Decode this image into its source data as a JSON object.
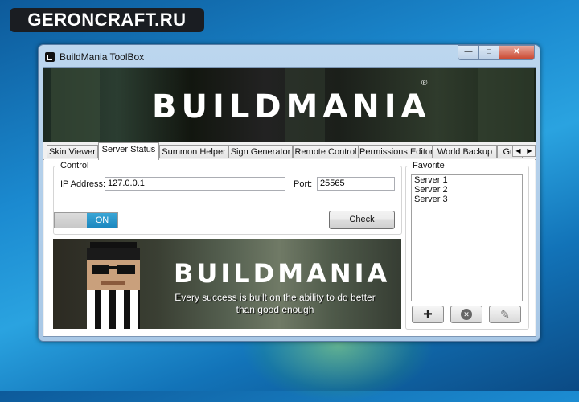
{
  "watermark": "GERONCRAFT.RU",
  "window": {
    "title": "BuildMania ToolBox",
    "controls": {
      "minimize": "—",
      "maximize": "□",
      "close": "✕"
    }
  },
  "banner": {
    "logo": "BUILDMANIA",
    "registered": "®"
  },
  "tabs": [
    {
      "label": "Skin Viewer",
      "active": false
    },
    {
      "label": "Server Status",
      "active": true
    },
    {
      "label": "Summon Helper",
      "active": false
    },
    {
      "label": "Sign Generator",
      "active": false
    },
    {
      "label": "Remote Control",
      "active": false
    },
    {
      "label": "Permissions Editor",
      "active": false
    },
    {
      "label": "World Backup",
      "active": false
    },
    {
      "label": "Gui",
      "active": false
    }
  ],
  "tab_nav": {
    "prev": "◀",
    "next": "▶"
  },
  "control": {
    "legend": "Control",
    "ip_label": "IP Address:",
    "ip_value": "127.0.0.1",
    "port_label": "Port:",
    "port_value": "25565",
    "toggle_label": "ON",
    "toggle_state": "on",
    "check_button": "Check"
  },
  "promo": {
    "logo": "BUILDMANIA",
    "slogan_line1": "Every success is built on the ability to do better",
    "slogan_line2": "than good enough"
  },
  "favorite": {
    "legend": "Favorite",
    "servers": [
      "Server 1",
      "Server 2",
      "Server 3"
    ],
    "buttons": {
      "add": "+",
      "remove": "✕",
      "edit": "✎"
    }
  }
}
